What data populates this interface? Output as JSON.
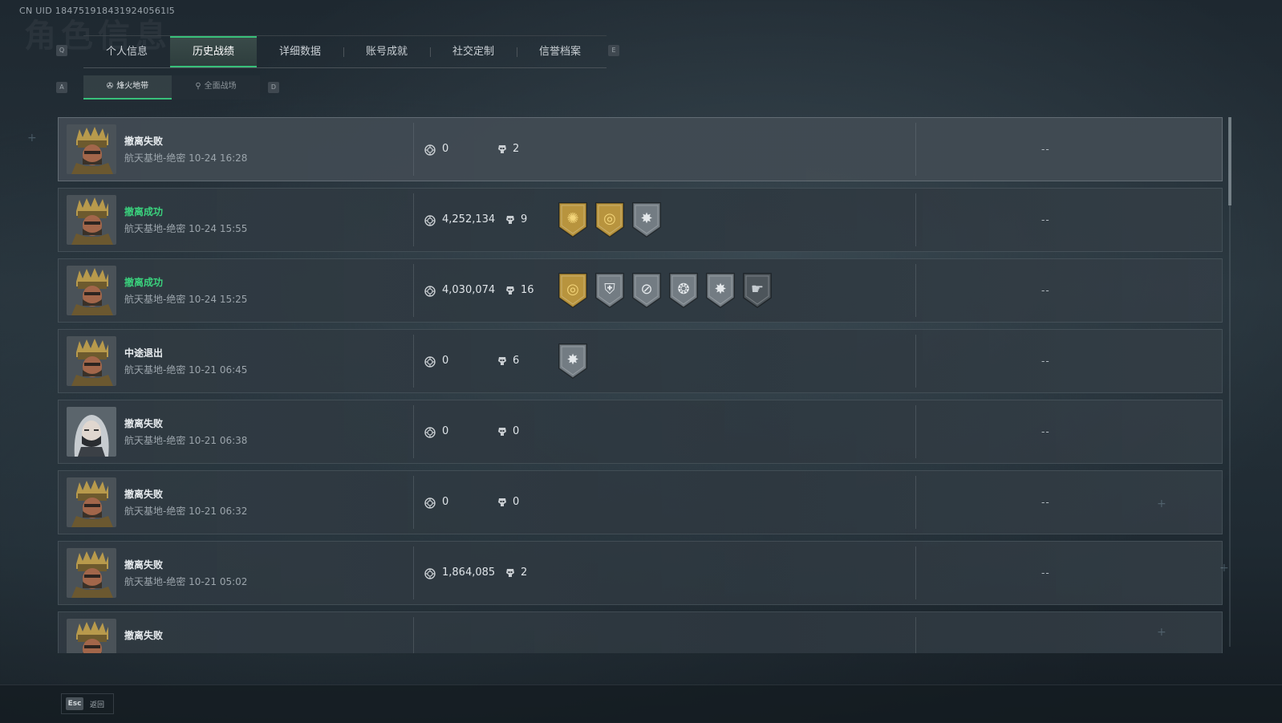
{
  "uid": "CN UID 1847519184319240561l5",
  "background_title": "角色信息",
  "tab_keys": {
    "left": "Q",
    "right": "E"
  },
  "tabs": [
    {
      "label": "个人信息",
      "active": false
    },
    {
      "label": "历史战绩",
      "active": true
    },
    {
      "label": "详细数据",
      "active": false
    },
    {
      "label": "账号成就",
      "active": false
    },
    {
      "label": "社交定制",
      "active": false
    },
    {
      "label": "信誉档案",
      "active": false
    }
  ],
  "subtab_keys": {
    "left": "A",
    "right": "D"
  },
  "subtabs": [
    {
      "label": "烽火地带",
      "active": true
    },
    {
      "label": "全面战场",
      "active": false
    }
  ],
  "matches": [
    {
      "status": "撤离失败",
      "result": "fail",
      "map": "航天基地-绝密",
      "time": "10-24 16:28",
      "value": "0",
      "kills": "2",
      "medals": [],
      "extra": "--",
      "avatar": "soldier"
    },
    {
      "status": "撤离成功",
      "result": "success",
      "map": "航天基地-绝密",
      "time": "10-24 15:55",
      "value": "4,252,134",
      "kills": "9",
      "medals": [
        "gold-sun-medal",
        "gold-ring-medal",
        "silver-star-medal"
      ],
      "extra": "--",
      "avatar": "soldier"
    },
    {
      "status": "撤离成功",
      "result": "success",
      "map": "航天基地-绝密",
      "time": "10-24 15:25",
      "value": "4,030,074",
      "kills": "16",
      "medals": [
        "gold-ring-medal",
        "silver-shield-medal",
        "silver-compass-medal",
        "silver-wings-medal",
        "silver-star-medal",
        "dark-hand-medal"
      ],
      "extra": "--",
      "avatar": "soldier"
    },
    {
      "status": "中途退出",
      "result": "quit",
      "map": "航天基地-绝密",
      "time": "10-21 06:45",
      "value": "0",
      "kills": "6",
      "medals": [
        "silver-star-medal"
      ],
      "extra": "--",
      "avatar": "soldier"
    },
    {
      "status": "撤离失败",
      "result": "fail",
      "map": "航天基地-绝密",
      "time": "10-21 06:38",
      "value": "0",
      "kills": "0",
      "medals": [],
      "extra": "--",
      "avatar": "hooded"
    },
    {
      "status": "撤离失败",
      "result": "fail",
      "map": "航天基地-绝密",
      "time": "10-21 06:32",
      "value": "0",
      "kills": "0",
      "medals": [],
      "extra": "--",
      "avatar": "soldier"
    },
    {
      "status": "撤离失败",
      "result": "fail",
      "map": "航天基地-绝密",
      "time": "10-21 05:02",
      "value": "1,864,085",
      "kills": "2",
      "medals": [],
      "extra": "--",
      "avatar": "soldier"
    },
    {
      "status": "撤离失败",
      "result": "fail",
      "map": "",
      "time": "",
      "value": "",
      "kills": "",
      "medals": [],
      "extra": "",
      "avatar": "soldier"
    }
  ],
  "footer": {
    "esc_key": "Esc",
    "esc_label": "返回"
  },
  "colors": {
    "accent": "#38c07a",
    "success_text": "#3ad27d",
    "gold": "#b8943e",
    "silver": "#8a939a"
  }
}
